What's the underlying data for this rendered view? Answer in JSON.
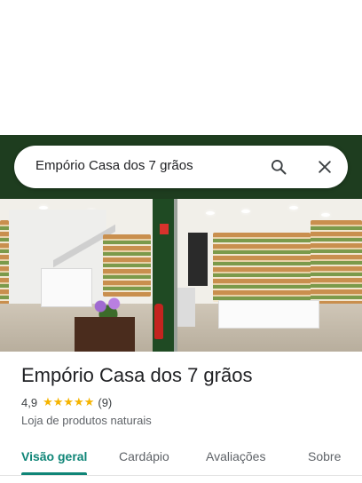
{
  "search": {
    "query": "Empório Casa dos 7 grãos",
    "search_icon": "search-icon",
    "close_icon": "close-icon"
  },
  "place": {
    "title": "Empório Casa dos 7 grãos",
    "rating": "4,9",
    "stars": "★★★★★",
    "star_value": 5,
    "review_count": "(9)",
    "category": "Loja de produtos naturais"
  },
  "tabs": [
    {
      "label": "Visão geral",
      "active": true
    },
    {
      "label": "Cardápio",
      "active": false
    },
    {
      "label": "Avaliações",
      "active": false
    },
    {
      "label": "Sobre",
      "active": false
    }
  ],
  "colors": {
    "accent": "#0f8577",
    "star": "#f5b400"
  }
}
